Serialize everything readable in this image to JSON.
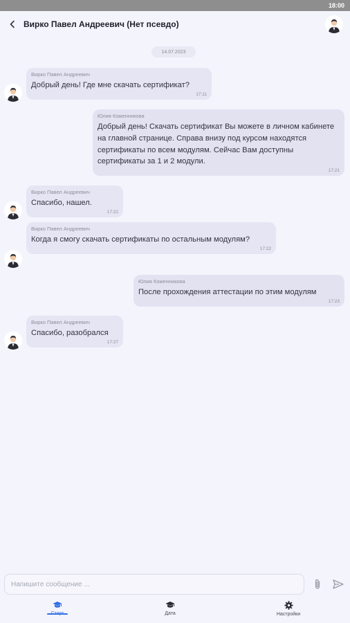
{
  "status_bar": {
    "time": "18:00"
  },
  "header": {
    "title": "Вирко Павел Андреевич (Нет псевдо)"
  },
  "date_chip": "14.07.2023",
  "messages": [
    {
      "direction": "in",
      "sender": "Вирко Павел Андреевич",
      "text": "Добрый день! Где мне скачать сертификат?",
      "time": "17:11"
    },
    {
      "direction": "out",
      "sender": "Юлия Коженникова",
      "text": "Добрый день! Скачать сертификат Вы можете в личном кабинете на главной странице. Справа внизу под курсом находятся сертификаты по всем модулям. Сейчас Вам доступны сертификаты за 1 и 2 модули.",
      "time": "17:21"
    },
    {
      "direction": "in",
      "sender": "Вирко Павел Андреевич",
      "text": "Спасибо, нашел.",
      "time": "17:22"
    },
    {
      "direction": "in",
      "sender": "Вирко Павел Андреевич",
      "text": "Когда я смогу скачать сертификаты по остальным модулям?",
      "time": "17:22"
    },
    {
      "direction": "out",
      "sender": "Юлия Коженникова",
      "text": "После прохождения аттестации по этим модулям",
      "time": "17:23"
    },
    {
      "direction": "in",
      "sender": "Вирко Павел Андреевич",
      "text": "Спасибо, разобрался",
      "time": "17:27"
    }
  ],
  "composer": {
    "placeholder": "Напишите сообщение ..."
  },
  "bottom_nav": [
    {
      "label": "Старт",
      "icon": "graduation-cap-icon",
      "active": true
    },
    {
      "label": "Дата",
      "icon": "graduation-cap-icon",
      "active": false
    },
    {
      "label": "Настройки",
      "icon": "gear-icon",
      "active": false
    }
  ],
  "colors": {
    "background": "#f4f4fc",
    "bubble": "#e5e5f3",
    "accent": "#2f6fe4"
  }
}
